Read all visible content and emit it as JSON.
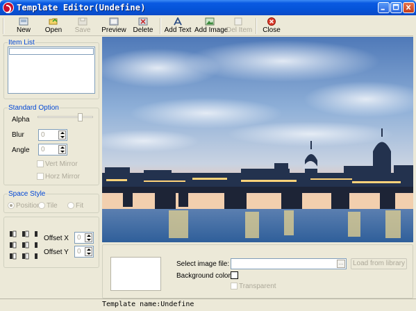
{
  "window": {
    "title": "Template Editor(Undefine)"
  },
  "toolbar": {
    "buttons": [
      {
        "label": "New",
        "icon": "new-icon",
        "enabled": true
      },
      {
        "label": "Open",
        "icon": "open-folder-icon",
        "enabled": true
      },
      {
        "label": "Save",
        "icon": "save-disk-icon",
        "enabled": false
      },
      {
        "label": "Preview",
        "icon": "preview-icon",
        "enabled": true
      },
      {
        "label": "Delete",
        "icon": "delete-icon",
        "enabled": true
      },
      {
        "label": "Add Text",
        "icon": "add-text-icon",
        "enabled": true
      },
      {
        "label": "Add Image",
        "icon": "add-image-icon",
        "enabled": true
      },
      {
        "label": "Del Item",
        "icon": "del-item-icon",
        "enabled": false
      },
      {
        "label": "Close",
        "icon": "close-red-icon",
        "enabled": true
      }
    ]
  },
  "item_list": {
    "title": "Item List",
    "items": []
  },
  "standard_option": {
    "title": "Standard Option",
    "alpha_label": "Alpha",
    "blur_label": "Blur",
    "blur_value": "0",
    "angle_label": "Angle",
    "angle_value": "0",
    "vert_mirror_label": "Vert Mirror",
    "horz_mirror_label": "Horz Mirror"
  },
  "space_style": {
    "title": "Space Style",
    "options": [
      "Position",
      "Tile",
      "Fit"
    ],
    "selected": "Position"
  },
  "offset": {
    "x_label": "Offset X",
    "x_value": "0",
    "y_label": "Offset Y",
    "y_value": "0"
  },
  "bottom": {
    "select_image_label": "Select image file:",
    "browse_button": "...",
    "load_library_button": "Load from library",
    "background_color_label": "Background color:",
    "transparent_label": "Transparent"
  },
  "status": {
    "text": "Template name:Undefine"
  },
  "colors": {
    "titlebar": "#0554d8",
    "face": "#ece9d8",
    "group_title": "#0046d5",
    "disabled": "#aca899"
  }
}
